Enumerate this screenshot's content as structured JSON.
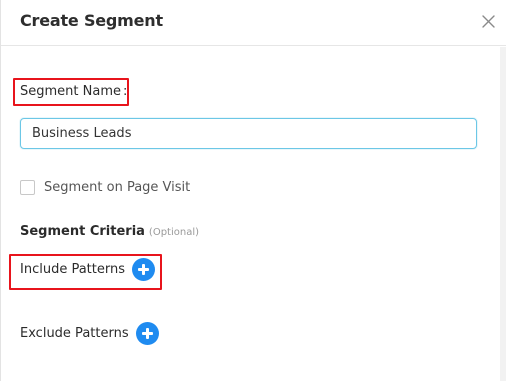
{
  "dialog": {
    "title": "Create Segment",
    "close_icon": "close-icon"
  },
  "segment_name": {
    "label": "Segment Name",
    "colon": ":",
    "value": "Business Leads",
    "focused_border_color": "#6cc7e6"
  },
  "page_visit": {
    "label": "Segment on Page Visit",
    "checked": false
  },
  "criteria": {
    "title": "Segment Criteria",
    "optional_note": "(Optional)"
  },
  "include": {
    "label": "Include Patterns",
    "add_icon": "plus-circle-icon"
  },
  "exclude": {
    "label": "Exclude Patterns",
    "add_icon": "plus-circle-icon"
  },
  "colors": {
    "accent": "#1f8bf0",
    "annotation": "#e8141c"
  }
}
